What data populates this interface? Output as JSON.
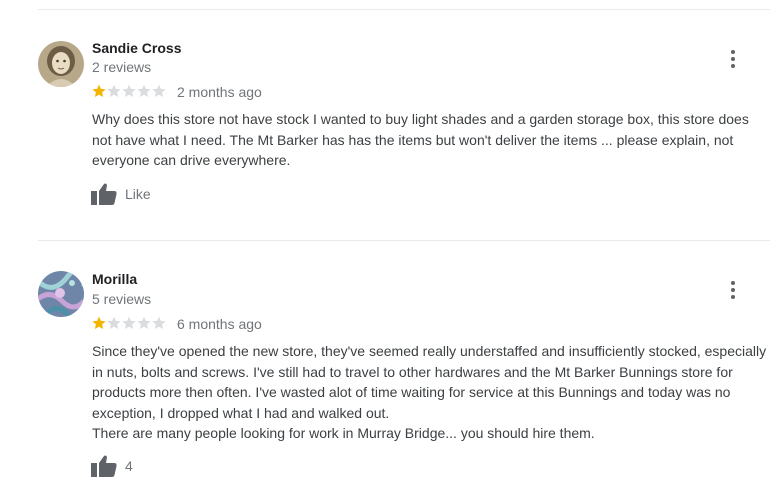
{
  "reviews": [
    {
      "author": "Sandie Cross",
      "review_count": "2 reviews",
      "rating": 1,
      "max_rating": 5,
      "date": "2 months ago",
      "text": [
        "Why does this store not have stock I wanted to buy light shades and a garden storage box, this store does not have what I need. The Mt Barker has has the items but won't deliver the items ... please explain, not everyone can drive everywhere."
      ],
      "like_label": "Like",
      "avatar_icon": "photo-avatar-icon",
      "more_icon": "more-vert-icon",
      "like_icon": "thumbs-up-icon"
    },
    {
      "author": "Morilla",
      "review_count": "5 reviews",
      "rating": 1,
      "max_rating": 5,
      "date": "6 months ago",
      "text": [
        "Since they've opened the new store, they've seemed really understaffed and insufficiently stocked, especially in nuts, bolts and screws. I've still had to travel to other hardwares and the Mt Barker Bunnings store for products more then often. I've wasted alot of time waiting for service at this Bunnings and today was no exception, I dropped what I had and walked out.",
        "There are many people looking for work in Murray Bridge... you should hire them."
      ],
      "like_label": "4",
      "avatar_icon": "photo-avatar-icon",
      "more_icon": "more-vert-icon",
      "like_icon": "thumbs-up-icon"
    }
  ],
  "colors": {
    "star_filled": "#f4b400",
    "star_empty": "#dadce0",
    "secondary_text": "#70757a",
    "body_text": "#3c4043",
    "divider": "#e8eaed"
  }
}
